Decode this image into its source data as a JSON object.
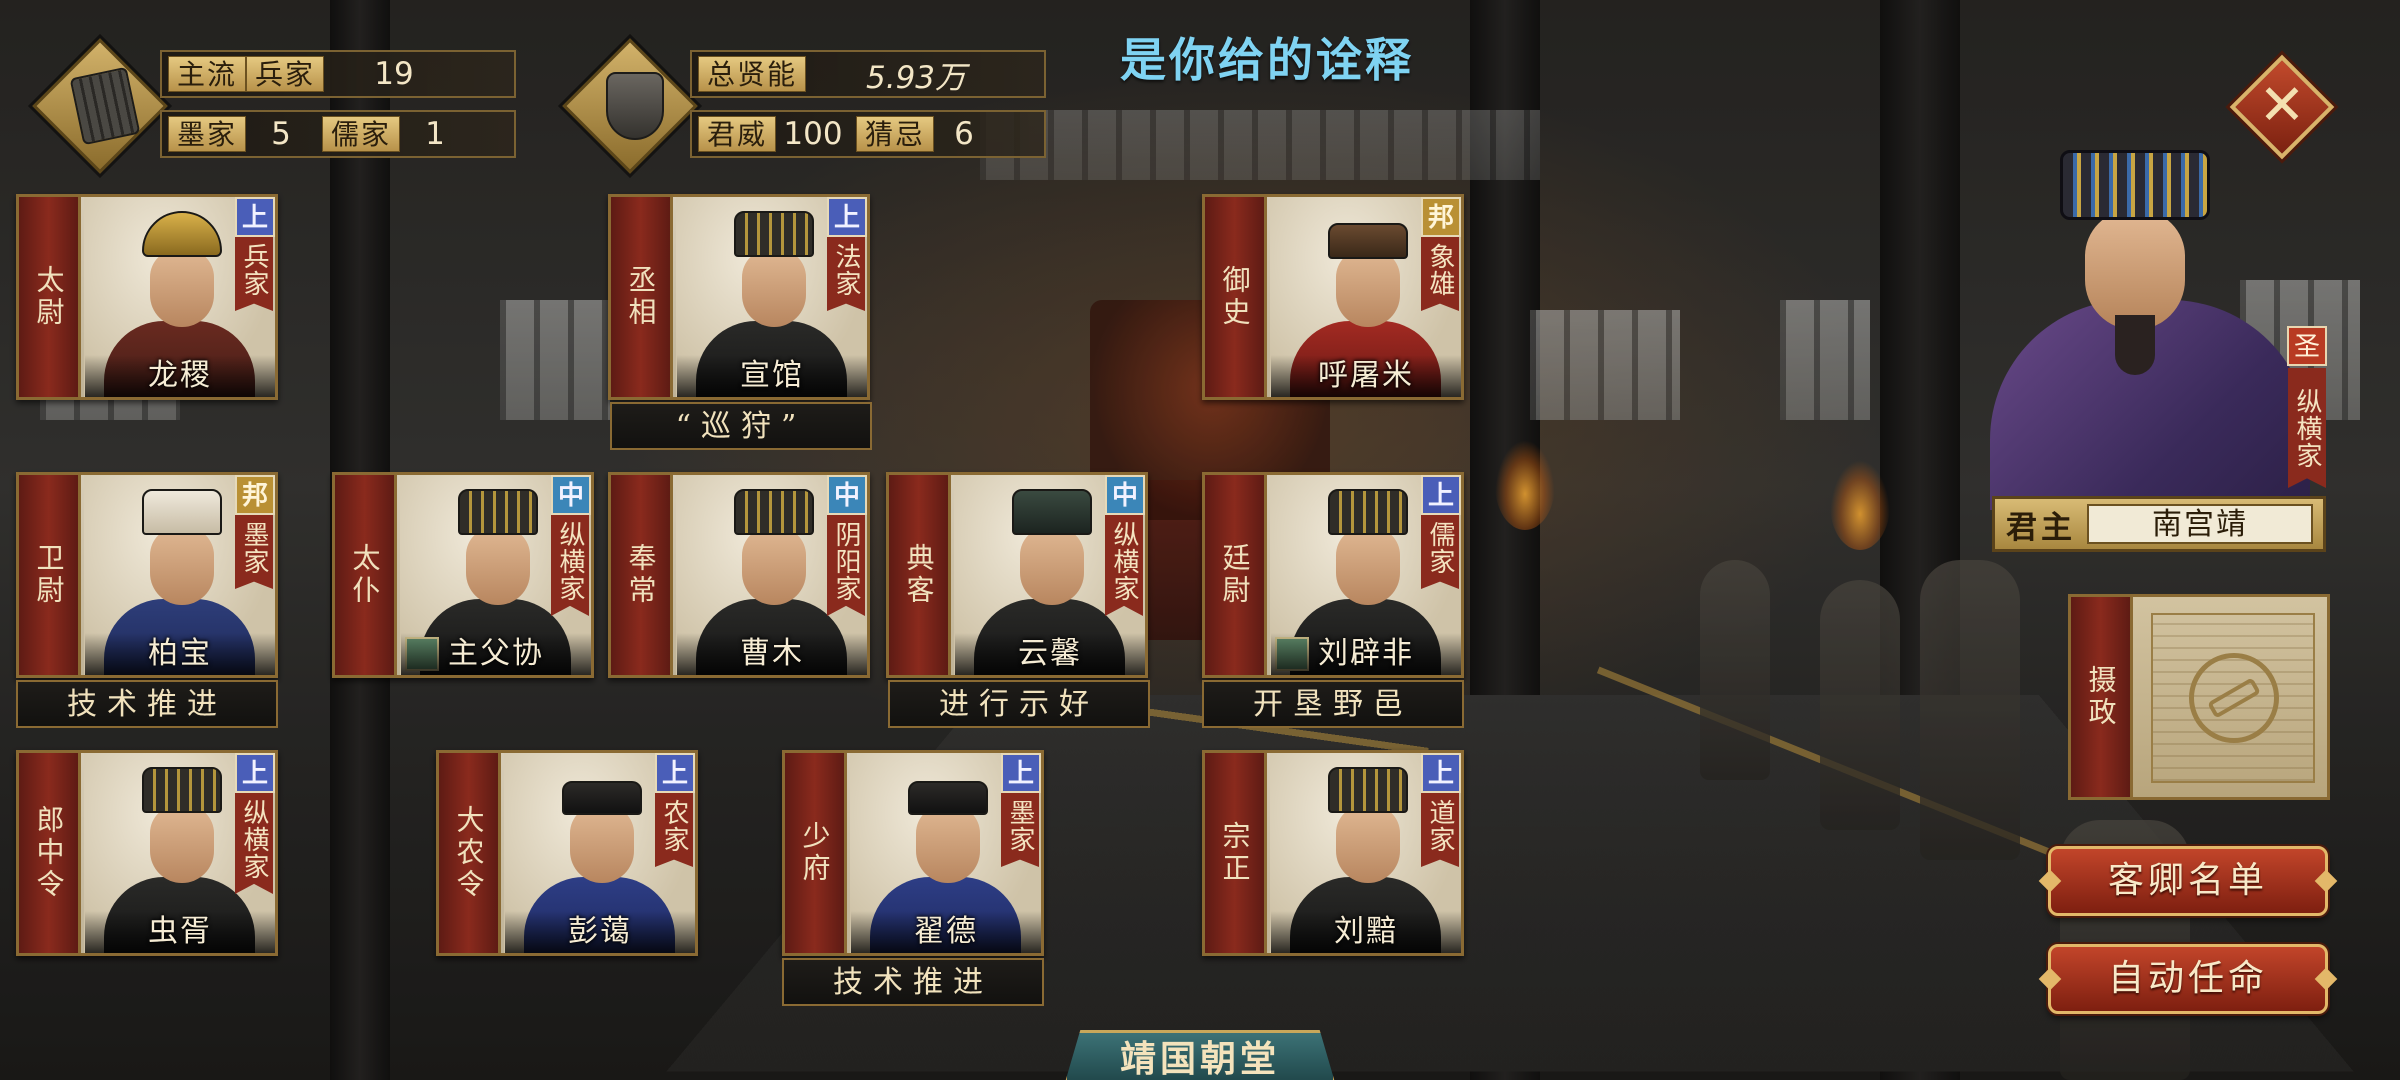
{
  "header": {
    "title": "是你给的诠释"
  },
  "schools_panel": {
    "row1": {
      "tag1": "主流",
      "tag2": "兵家",
      "value": "19"
    },
    "row2": {
      "tag1": "墨家",
      "value1": "5",
      "tag2": "儒家",
      "value2": "1"
    }
  },
  "talent_panel": {
    "row1": {
      "tag": "总贤能",
      "value": "5.93万"
    },
    "row2": {
      "tag1": "君威",
      "value1": "100",
      "tag2": "猜忌",
      "value2": "6"
    }
  },
  "officials": [
    {
      "post": "太尉",
      "name": "龙稷",
      "rank": "上",
      "school": "兵家",
      "policy": ""
    },
    {
      "post": "丞相",
      "name": "宣馆",
      "rank": "上",
      "school": "法家",
      "policy": "“巡狩”"
    },
    {
      "post": "御史",
      "name": "呼屠米",
      "rank": "邦",
      "school": "象雄",
      "policy": ""
    },
    {
      "post": "卫尉",
      "name": "柏宝",
      "rank": "邦",
      "school": "墨家",
      "policy": "技术推进"
    },
    {
      "post": "太仆",
      "name": "主父协",
      "rank": "中",
      "school": "纵横家",
      "policy": ""
    },
    {
      "post": "奉常",
      "name": "曹木",
      "rank": "中",
      "school": "阴阳家",
      "policy": ""
    },
    {
      "post": "典客",
      "name": "云馨",
      "rank": "中",
      "school": "纵横家",
      "policy": "进行示好"
    },
    {
      "post": "廷尉",
      "name": "刘辟非",
      "rank": "上",
      "school": "儒家",
      "policy": "开垦野邑"
    },
    {
      "post": "郎中令",
      "name": "虫胥",
      "rank": "上",
      "school": "纵横家",
      "policy": ""
    },
    {
      "post": "大农令",
      "name": "彭蔼",
      "rank": "上",
      "school": "农家",
      "policy": ""
    },
    {
      "post": "少府",
      "name": "翟德",
      "rank": "上",
      "school": "墨家",
      "policy": "技术推进"
    },
    {
      "post": "宗正",
      "name": "刘黯",
      "rank": "上",
      "school": "道家",
      "policy": ""
    }
  ],
  "ruler": {
    "rank": "圣",
    "school": "纵横家",
    "title": "君主",
    "name": "南宫靖"
  },
  "regent": {
    "post": "摄政"
  },
  "buttons": {
    "guest_list": "客卿名单",
    "auto_appoint": "自动任命"
  },
  "bottom_tab": {
    "label": "靖国朝堂"
  },
  "icons": {
    "close": "close-icon",
    "scroll": "bamboo-scroll-icon",
    "tripod": "bronze-tripod-icon"
  },
  "colors": {
    "title": "#7fd3f2",
    "accent_red": "#8a2a1d",
    "gold": "#c8a75a",
    "rank_shang": "#4a5eb8",
    "rank_zhong": "#3b86b8",
    "rank_bang": "#b99034"
  }
}
